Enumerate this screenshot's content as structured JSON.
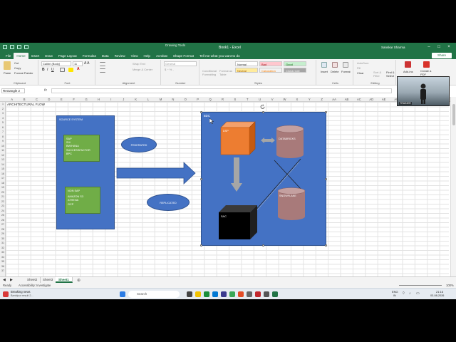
{
  "window": {
    "title": "Book1 - Excel",
    "context_tab": "Drawing Tools",
    "user": "Sanskar Sharma"
  },
  "ribbon_tabs": [
    "File",
    "Home",
    "Insert",
    "Draw",
    "Page Layout",
    "Formulas",
    "Data",
    "Review",
    "View",
    "Help",
    "Acrobat",
    "Shape Format"
  ],
  "tell_me": "Tell me what you want to do",
  "share_label": "Share",
  "clipboard": {
    "paste": "Paste",
    "cut": "Cut",
    "copy": "Copy",
    "format_painter": "Format Painter",
    "label": "Clipboard"
  },
  "font": {
    "name": "Calibri (Body)",
    "size": "11",
    "label": "Font"
  },
  "alignment": {
    "wrap": "Wrap Text",
    "merge": "Merge & Center",
    "label": "Alignment"
  },
  "number": {
    "format": "General",
    "label": "Number"
  },
  "styles": {
    "conditional": "Conditional Formatting",
    "format_as_table": "Format as Table",
    "cells": [
      "Normal",
      "Bad",
      "Good",
      "Neutral",
      "Calculation",
      "Check Cell"
    ],
    "label": "Styles"
  },
  "cells_group": {
    "insert": "Insert",
    "delete": "Delete",
    "format": "Format",
    "label": "Cells"
  },
  "editing": {
    "autosum": "AutoSum",
    "fill": "Fill",
    "clear": "Clear",
    "sort": "Sort & Filter",
    "find": "Find & Select",
    "label": "Editing"
  },
  "addins": {
    "add_in": "Add-ins",
    "create_pdf": "Create a PDF"
  },
  "name_box": "Rectangle 2",
  "columns": [
    "A",
    "B",
    "C",
    "D",
    "E",
    "F",
    "G",
    "H",
    "I",
    "J",
    "K",
    "L",
    "M",
    "N",
    "O",
    "P",
    "Q",
    "R",
    "S",
    "T",
    "U",
    "V",
    "W",
    "X",
    "Y",
    "Z",
    "AA",
    "AB",
    "AC",
    "AD",
    "AE",
    "AF",
    "AG",
    "AH",
    "AI",
    "AJ"
  ],
  "sheet": {
    "a1": "ARCHITECTURAL FLOW",
    "source_title": "SOURCE SYSTEM",
    "sap_lines": [
      "SAP",
      "S/4",
      "BW/HANA",
      "SUCCESSFACTOR",
      "BPC"
    ],
    "nonsap_lines": [
      "NON SAP",
      "",
      "AMAZON S3",
      "ATHENA",
      "GCP"
    ],
    "federated": "FEDERATED",
    "replicated": "REPLICATED",
    "bdc": "BDC",
    "dsp": "DSP",
    "databricks": "DATABRICKS",
    "snowflake": "SNOWFLAKE",
    "sac": "SAC"
  },
  "sheet_tabs": [
    "Sheet2",
    "Sheet3",
    "Sheet1"
  ],
  "status": {
    "ready": "Ready",
    "accessibility": "Accessibility: Investigate",
    "zoom": "100%"
  },
  "taskbar": {
    "news_title": "Breaking news",
    "news_sub": "Bankipur result 2...",
    "search": "Search",
    "lang": "ENG",
    "lang_sub": "IN",
    "time": "21:16",
    "date": "03-08-2026"
  },
  "webcam": {
    "label": "TRAINER"
  },
  "colors": {
    "excel_green": "#217346",
    "shape_blue": "#4472c4",
    "dsp_orange": "#ed7d31",
    "cylinder": "#a87a7a"
  }
}
